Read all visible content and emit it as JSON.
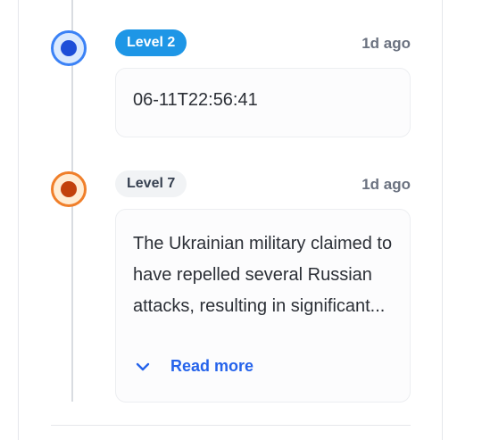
{
  "timeline": {
    "entries": [
      {
        "level": "Level 2",
        "time": "1d ago",
        "text": "06-11T22:56:41",
        "marker_color": "#3b82f6",
        "badge_color": "#1e96e6"
      },
      {
        "level": "Level 7",
        "time": "1d ago",
        "text": "The Ukrainian military claimed to have repelled several Russian attacks, resulting in significant...",
        "marker_color": "#f07f2a",
        "badge_color": "#f1f3f5",
        "read_more": "Read more",
        "read_more_icon": "chevron-down-icon"
      }
    ]
  }
}
